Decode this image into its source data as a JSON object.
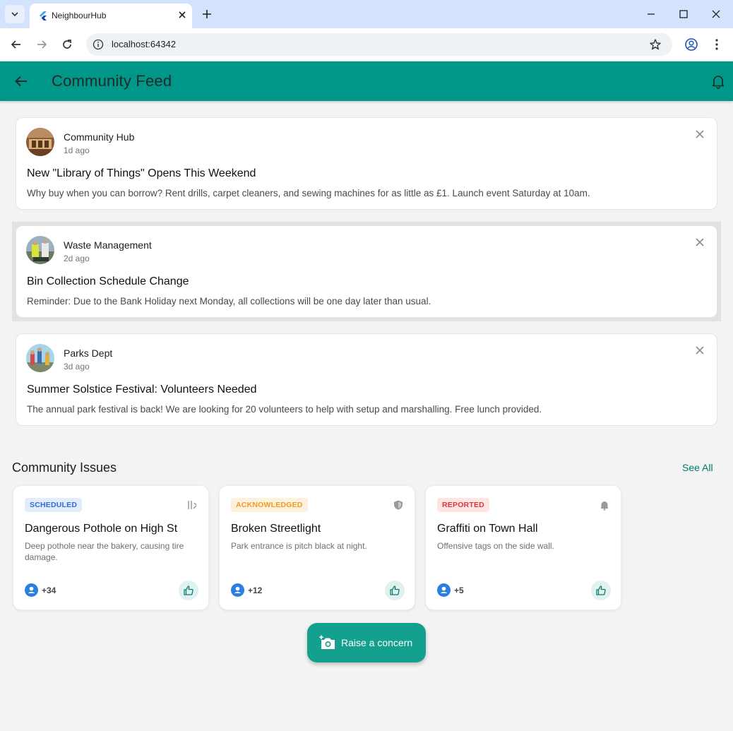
{
  "browser": {
    "tab_title": "NeighbourHub",
    "url": "localhost:64342"
  },
  "appbar": {
    "title": "Community Feed"
  },
  "feed": [
    {
      "author": "Community Hub",
      "time": "1d ago",
      "title": "New \"Library of Things\" Opens This Weekend",
      "body": "Why buy when you can borrow? Rent drills, carpet cleaners, and sewing machines for as little as £1. Launch event Saturday at 10am."
    },
    {
      "author": "Waste Management",
      "time": "2d ago",
      "title": "Bin Collection Schedule Change",
      "body": "Reminder: Due to the Bank Holiday next Monday, all collections will be one day later than usual."
    },
    {
      "author": "Parks Dept",
      "time": "3d ago",
      "title": "Summer Solstice Festival: Volunteers Needed",
      "body": "The annual park festival is back! We are looking for 20 volunteers to help with setup and marshalling. Free lunch provided."
    }
  ],
  "issues_section": {
    "title": "Community Issues",
    "see_all": "See All"
  },
  "issues": [
    {
      "status": "SCHEDULED",
      "status_icon": "schedule-tools-icon",
      "title": "Dangerous Pothole on High St",
      "description": "Deep pothole near the bakery, causing tire damage.",
      "count": "+34"
    },
    {
      "status": "ACKNOWLEDGED",
      "status_icon": "shield-icon",
      "title": "Broken Streetlight",
      "description": "Park entrance is pitch black at night.",
      "count": "+12"
    },
    {
      "status": "REPORTED",
      "status_icon": "bell-icon",
      "title": "Graffiti on Town Hall",
      "description": "Offensive tags on the side wall.",
      "count": "+5"
    }
  ],
  "fab": {
    "label": "Raise a concern"
  },
  "colors": {
    "primary": "#009688",
    "fab": "#14a08f",
    "scheduled": "#2f6fd8",
    "acknowledged": "#f29b25",
    "reported": "#d93838"
  }
}
